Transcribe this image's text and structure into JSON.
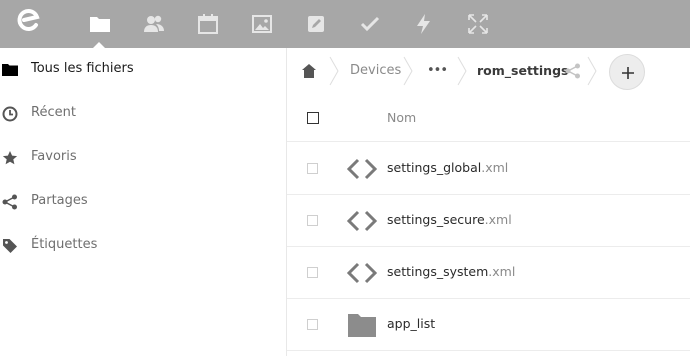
{
  "topbar": {
    "background": "#a7a7a7",
    "apps": [
      {
        "name": "files",
        "icon": "folder-icon",
        "active": true
      },
      {
        "name": "contacts",
        "icon": "contacts-icon"
      },
      {
        "name": "calendar",
        "icon": "calendar-icon"
      },
      {
        "name": "gallery",
        "icon": "image-icon"
      },
      {
        "name": "notes",
        "icon": "edit-icon"
      },
      {
        "name": "tasks",
        "icon": "checkmark-icon"
      },
      {
        "name": "activity",
        "icon": "lightning-icon"
      },
      {
        "name": "fullscreen",
        "icon": "expand-icon"
      }
    ]
  },
  "sidebar": {
    "items": [
      {
        "label": "Tous les fichiers",
        "icon": "folder-icon",
        "active": true
      },
      {
        "label": "Récent",
        "icon": "clock-icon"
      },
      {
        "label": "Favoris",
        "icon": "star-icon"
      },
      {
        "label": "Partages",
        "icon": "share-icon"
      },
      {
        "label": "Étiquettes",
        "icon": "tag-icon"
      }
    ]
  },
  "breadcrumb": {
    "home_icon": "home-icon",
    "items": [
      "Devices",
      "•••",
      "rom_settings"
    ],
    "share_icon": "share-icon",
    "new_button_icon": "plus-icon"
  },
  "filelist": {
    "header": {
      "name": "Nom"
    },
    "files": [
      {
        "base": "settings_global",
        "ext": ".xml",
        "icon": "code-icon"
      },
      {
        "base": "settings_secure",
        "ext": ".xml",
        "icon": "code-icon"
      },
      {
        "base": "settings_system",
        "ext": ".xml",
        "icon": "code-icon"
      },
      {
        "base": "app_list",
        "ext": "",
        "icon": "folder-icon"
      }
    ]
  }
}
